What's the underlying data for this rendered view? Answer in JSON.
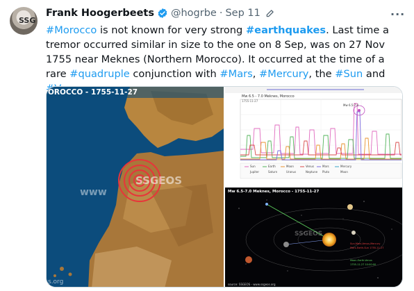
{
  "author": {
    "name": "Frank Hoogerbeets",
    "handle": "@hogrbe",
    "separator": "·",
    "date": "Sep 11",
    "avatar_text": "SSG"
  },
  "tweet": {
    "parts": [
      {
        "t": "#Morocco",
        "h": true
      },
      {
        "t": " is not known for very strong "
      },
      {
        "t": "#earthquakes",
        "h": true,
        "b": true
      },
      {
        "t": ". Last time a tremor occurred similar in size to the one on 8 Sep, was on 27 Nov 1755 near Meknes (Northern Morocco). It occurred at the time of a rare "
      },
      {
        "t": "#quadruple",
        "h": true
      },
      {
        "t": " conjunction with "
      },
      {
        "t": "#Mars",
        "h": true
      },
      {
        "t": ", "
      },
      {
        "t": "#Mercury",
        "h": true
      },
      {
        "t": ", the "
      },
      {
        "t": "#Sun",
        "h": true
      },
      {
        "t": " and "
      },
      {
        "t": "#Venus",
        "h": true
      },
      {
        "t": "."
      }
    ]
  },
  "media": {
    "map_title": "OROCCO - 1755-11-27",
    "map_watermark": "SSGEOS",
    "map_footer": "s.org",
    "map_footer_left": "www",
    "chart_title": "Mw 6.5 - 7.0 Meknes, Morocco",
    "chart_subtitle": "1755-11-27",
    "space_title": "Mw 6.5-7.0 Meknes, Morocco - 1755-11-27",
    "space_source": "source: SSGEOS - www.ssgeos.org",
    "space_watermark": "SSGEOS"
  },
  "colors": {
    "link": "#1d9bf0",
    "muted": "#536471",
    "verified": "#1d9bf0"
  }
}
